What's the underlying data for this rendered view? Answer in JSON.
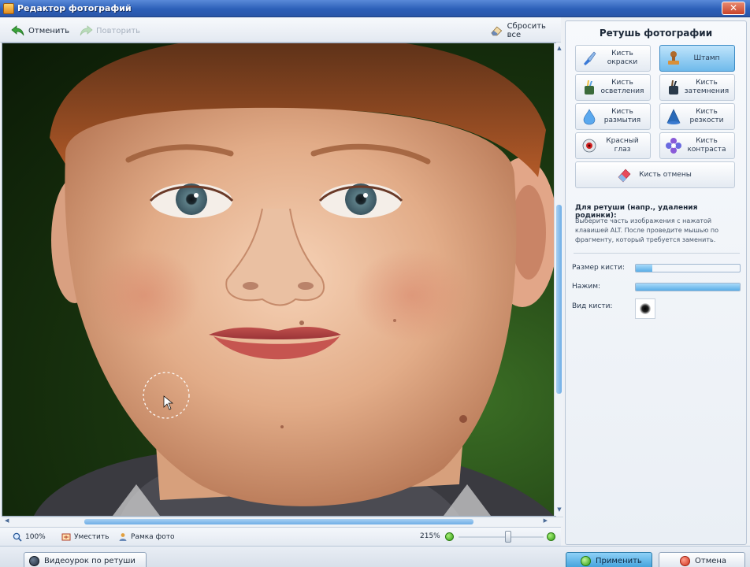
{
  "window": {
    "title": "Редактор фотографий",
    "close_label": "✕"
  },
  "toolbar": {
    "undo_label": "Отменить",
    "redo_label": "Повторить",
    "reset_label": "Сбросить все"
  },
  "photo": {
    "alt_description": "photo-being-retouched"
  },
  "status": {
    "zoom_label": "100%",
    "fit_label": "Уместить",
    "frame_label": "Рамка фото",
    "zoom_percent": "215%",
    "zoom_slider_value_pct": 58
  },
  "bottom": {
    "video_label": "Видеоурок по ретуши",
    "apply_label": "Применить",
    "cancel_label": "Отмена"
  },
  "panel": {
    "title": "Ретушь фотографии",
    "tools": [
      {
        "label": "Кисть окраски",
        "active": false
      },
      {
        "label": "Штамп",
        "active": true
      },
      {
        "label": "Кисть осветления",
        "active": false
      },
      {
        "label": "Кисть затемнения",
        "active": false
      },
      {
        "label": "Кисть размытия",
        "active": false
      },
      {
        "label": "Кисть резкости",
        "active": false
      },
      {
        "label": "Красный глаз",
        "active": false
      },
      {
        "label": "Кисть контраста",
        "active": false
      },
      {
        "label": "Кисть отмены",
        "active": false
      }
    ],
    "hint_title": "Для ретуши (напр., удаления родинки):",
    "hint_text": "Выберите часть изображения с нажатой клавишей ALT. После проведите мышью по фрагменту, который требуется заменить.",
    "params": {
      "size_label": "Размер кисти:",
      "size_value_pct": 16,
      "pressure_label": "Нажим:",
      "pressure_value_pct": 100,
      "brush_type_label": "Вид кисти:"
    }
  },
  "colors": {
    "titlebar": "#2c5fb8",
    "accent_blue": "#6fbaeb",
    "apply_green": "#2c9a12",
    "cancel_red": "#d0301b"
  }
}
